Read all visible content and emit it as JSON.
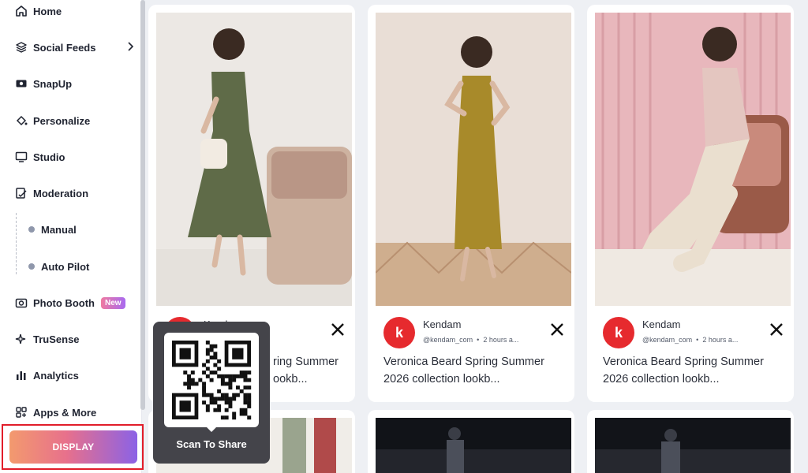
{
  "sidebar": {
    "items": [
      {
        "label": "Home",
        "icon": "home-icon"
      },
      {
        "label": "Social Feeds",
        "icon": "layers-icon"
      },
      {
        "label": "SnapUp",
        "icon": "snapup-icon"
      },
      {
        "label": "Personalize",
        "icon": "paint-bucket-icon"
      },
      {
        "label": "Studio",
        "icon": "monitor-icon"
      },
      {
        "label": "Moderation",
        "icon": "moderation-icon"
      },
      {
        "label": "Photo Booth",
        "icon": "camera-icon",
        "badge": "New"
      },
      {
        "label": "TruSense",
        "icon": "sparkle-icon"
      },
      {
        "label": "Analytics",
        "icon": "bar-chart-icon"
      },
      {
        "label": "Apps & More",
        "icon": "apps-grid-icon"
      }
    ],
    "moderation_sub": [
      {
        "label": "Manual"
      },
      {
        "label": "Auto Pilot"
      }
    ],
    "display_button": "DISPLAY"
  },
  "posts": [
    {
      "author": "Kendam",
      "handle": "@kendam_com",
      "time": "2 hours a...",
      "caption": "Veronica Beard Spring Summer 2026 collection lookb...",
      "avatar_letter": "k",
      "bg": "#ece8e4",
      "dress": "#5f6b48"
    },
    {
      "author": "Kendam",
      "handle": "@kendam_com",
      "time": "2 hours a...",
      "caption": "Veronica Beard Spring Summer 2026 collection lookb...",
      "avatar_letter": "k",
      "bg": "#e9ded6",
      "dress": "#a88a2a"
    },
    {
      "author": "Kendam",
      "handle": "@kendam_com",
      "time": "2 hours a...",
      "caption": "Veronica Beard Spring Summer 2026 collection lookb...",
      "avatar_letter": "k",
      "bg": "#e8b7bc",
      "dress": "#eadfcf"
    }
  ],
  "first_caption_visible": "ring Summer\nookb...",
  "qr_popup": {
    "label": "Scan To Share"
  },
  "colors": {
    "accent": "#e62a2e",
    "display_gradient": [
      "#f39a6e",
      "#8b62e6"
    ],
    "highlight_border": "#e11d2a"
  }
}
